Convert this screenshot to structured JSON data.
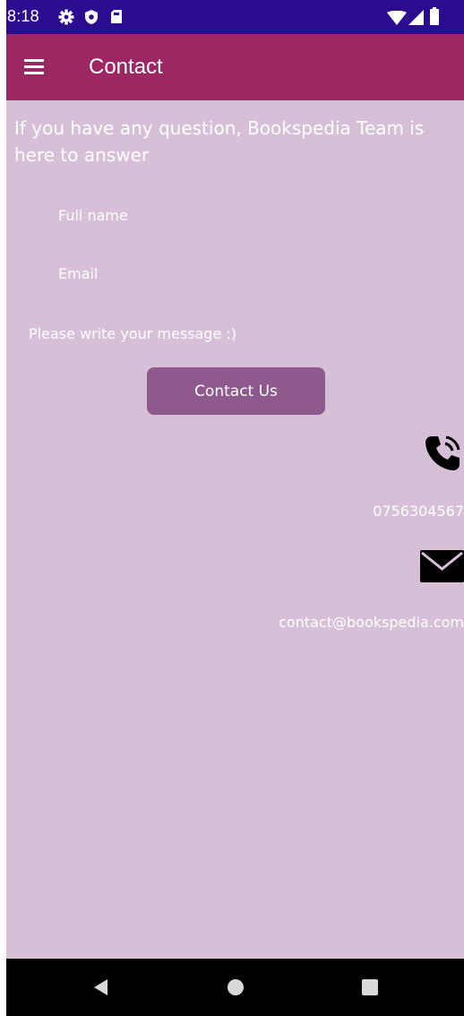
{
  "status_bar": {
    "time": "8:18",
    "icons": [
      "gear-icon",
      "shield-icon",
      "sd-card-icon",
      "wifi-icon",
      "signal-icon",
      "battery-icon"
    ]
  },
  "app_bar": {
    "title": "Contact",
    "menu_icon": "hamburger-menu-icon"
  },
  "intro_text": "If you have any question, Bookspedia Team is here to answer",
  "form": {
    "full_name_placeholder": "Full name",
    "full_name_value": "",
    "email_placeholder": "Email",
    "email_value": "",
    "message_placeholder": "Please write your message :)",
    "message_value": "",
    "submit_label": "Contact Us"
  },
  "contact_info": {
    "phone_icon": "phone-icon",
    "phone": "0756304567",
    "mail_icon": "mail-icon",
    "email": "contact@bookspedia.com"
  },
  "nav_bar": {
    "buttons": [
      "back-icon",
      "home-icon",
      "recents-icon"
    ]
  },
  "colors": {
    "status_bar": "#2c0c8e",
    "app_bar": "#9c2763",
    "background": "#d8bfd8",
    "button": "#8e5a8d",
    "nav_bar": "#000000"
  }
}
